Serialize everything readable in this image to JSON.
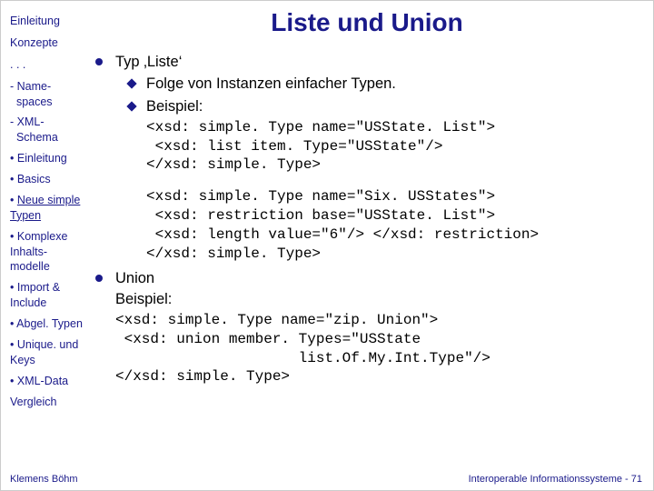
{
  "title": "Liste und Union",
  "sidebar": {
    "items": [
      "Einleitung",
      "Konzepte",
      ". . .",
      "- Name-\n  spaces",
      "- XML-\n  Schema"
    ],
    "bulleted": [
      "Einleitung",
      "Basics",
      "Neue simple Typen",
      "Komplexe Inhalts-modelle",
      "Import & Include",
      "Abgel. Typen",
      "Unique. und Keys",
      "XML-Data"
    ],
    "trailing": "Vergleich"
  },
  "bullets": [
    {
      "label": "Typ ‚Liste‘",
      "subs": [
        {
          "label": "Folge von Instanzen einfacher Typen."
        },
        {
          "label": "Beispiel:",
          "code": "<xsd: simple. Type name=\"USState. List\">\n <xsd: list item. Type=\"USState\"/>\n</xsd: simple. Type>",
          "code2": "<xsd: simple. Type name=\"Six. USStates\">\n <xsd: restriction base=\"USState. List\">\n <xsd: length value=\"6\"/> </xsd: restriction>\n</xsd: simple. Type>"
        }
      ]
    },
    {
      "label": "Union",
      "extra": "Beispiel:",
      "code": "<xsd: simple. Type name=\"zip. Union\">\n <xsd: union member. Types=\"USState\n                     list.Of.My.Int.Type\"/>\n</xsd: simple. Type>"
    }
  ],
  "footer": {
    "left": "Klemens Böhm",
    "right": "Interoperable Informationssysteme - 71"
  }
}
